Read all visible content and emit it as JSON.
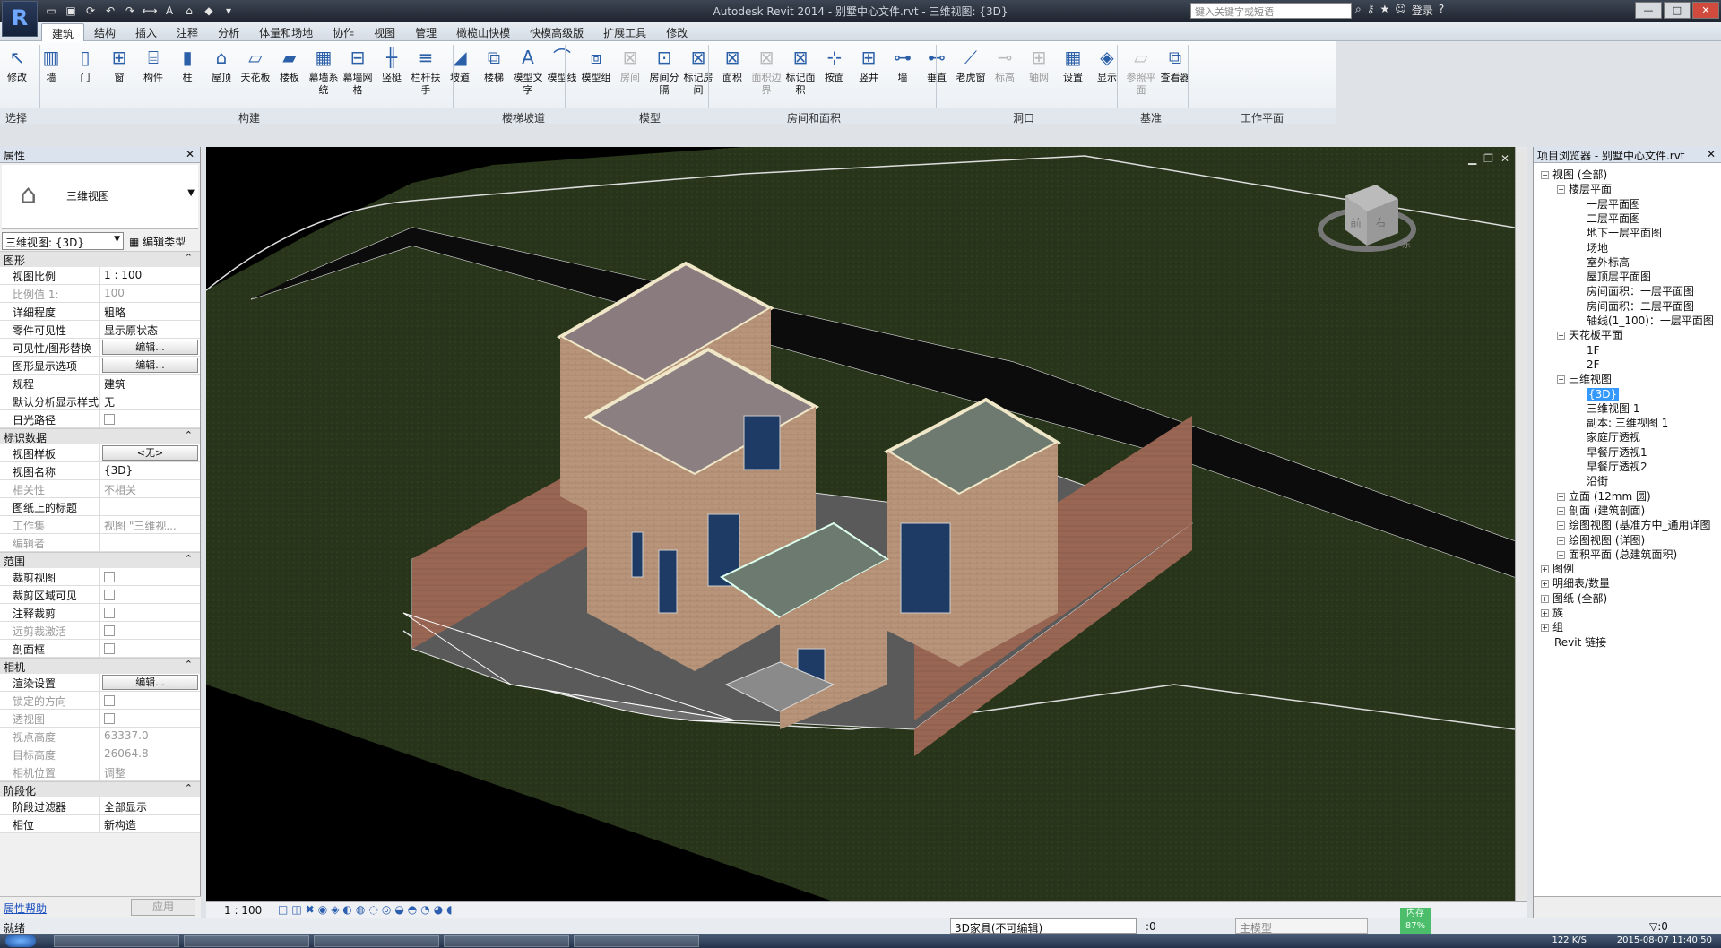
{
  "window": {
    "title": "Autodesk Revit 2014 -    别墅中心文件.rvt - 三维视图: {3D}",
    "search_placeholder": "键入关键字或短语",
    "login": "登录",
    "buttons": {
      "min": "—",
      "max": "□",
      "close": "✕"
    }
  },
  "tabs": [
    "建筑",
    "结构",
    "插入",
    "注释",
    "分析",
    "体量和场地",
    "协作",
    "视图",
    "管理",
    "橄榄山快模",
    "快模高级版",
    "扩展工具",
    "修改"
  ],
  "ribbon": {
    "tools": [
      {
        "label": "修改",
        "icon": "cursor-icon",
        "disabled": false
      },
      {
        "label": "墙",
        "icon": "wall-icon",
        "disabled": false
      },
      {
        "label": "门",
        "icon": "door-icon",
        "disabled": false
      },
      {
        "label": "窗",
        "icon": "window-icon",
        "disabled": false
      },
      {
        "label": "构件",
        "icon": "component-icon",
        "disabled": false
      },
      {
        "label": "柱",
        "icon": "column-icon",
        "disabled": false
      },
      {
        "label": "屋顶",
        "icon": "roof-icon",
        "disabled": false
      },
      {
        "label": "天花板",
        "icon": "ceiling-icon",
        "disabled": false
      },
      {
        "label": "楼板",
        "icon": "floor-icon",
        "disabled": false
      },
      {
        "label": "幕墙系统",
        "icon": "curtain-system-icon",
        "disabled": false
      },
      {
        "label": "幕墙网格",
        "icon": "curtain-grid-icon",
        "disabled": false
      },
      {
        "label": "竖梃",
        "icon": "mullion-icon",
        "disabled": false
      },
      {
        "label": "栏杆扶手",
        "icon": "railing-icon",
        "disabled": false
      },
      {
        "label": "坡道",
        "icon": "ramp-icon",
        "disabled": false
      },
      {
        "label": "楼梯",
        "icon": "stair-icon",
        "disabled": false
      },
      {
        "label": "模型文字",
        "icon": "model-text-icon",
        "disabled": false
      },
      {
        "label": "模型线",
        "icon": "model-line-icon",
        "disabled": false
      },
      {
        "label": "模型组",
        "icon": "model-group-icon",
        "disabled": false
      },
      {
        "label": "房间",
        "icon": "room-icon",
        "disabled": true
      },
      {
        "label": "房间分隔",
        "icon": "room-separator-icon",
        "disabled": false
      },
      {
        "label": "标记房间",
        "icon": "tag-room-icon",
        "disabled": false
      },
      {
        "label": "面积",
        "icon": "area-icon",
        "disabled": false
      },
      {
        "label": "面积边界",
        "icon": "area-boundary-icon",
        "disabled": true
      },
      {
        "label": "标记面积",
        "icon": "tag-area-icon",
        "disabled": false
      },
      {
        "label": "按面",
        "icon": "by-face-icon",
        "disabled": false
      },
      {
        "label": "竖井",
        "icon": "shaft-icon",
        "disabled": false
      },
      {
        "label": "墙",
        "icon": "wall-opening-icon",
        "disabled": false
      },
      {
        "label": "垂直",
        "icon": "vertical-opening-icon",
        "disabled": false
      },
      {
        "label": "老虎窗",
        "icon": "dormer-icon",
        "disabled": false
      },
      {
        "label": "标高",
        "icon": "level-icon",
        "disabled": true
      },
      {
        "label": "轴网",
        "icon": "grid-icon",
        "disabled": true
      },
      {
        "label": "设置",
        "icon": "workplane-set-icon",
        "disabled": false
      },
      {
        "label": "显示",
        "icon": "workplane-show-icon",
        "disabled": false
      },
      {
        "label": "参照平面",
        "icon": "ref-plane-icon",
        "disabled": true
      },
      {
        "label": "查看器",
        "icon": "viewer-icon",
        "disabled": false
      }
    ],
    "panels": [
      "选择",
      "构建",
      "楼梯坡道",
      "模型",
      "房间和面积",
      "洞口",
      "基准",
      "工作平面"
    ]
  },
  "properties": {
    "title": "属性",
    "type_name": "三维视图",
    "view_selector": "三维视图: {3D}",
    "edit_type": "编辑类型",
    "sections": [
      {
        "name": "图形",
        "rows": [
          {
            "k": "视图比例",
            "v": "1 : 100",
            "type": "text"
          },
          {
            "k": "比例值 1:",
            "v": "100",
            "type": "text",
            "dim": true
          },
          {
            "k": "详细程度",
            "v": "粗略",
            "type": "text"
          },
          {
            "k": "零件可见性",
            "v": "显示原状态",
            "type": "text"
          },
          {
            "k": "可见性/图形替换",
            "v": "编辑...",
            "type": "button"
          },
          {
            "k": "图形显示选项",
            "v": "编辑...",
            "type": "button"
          },
          {
            "k": "规程",
            "v": "建筑",
            "type": "text"
          },
          {
            "k": "默认分析显示样式",
            "v": "无",
            "type": "text"
          },
          {
            "k": "日光路径",
            "v": "",
            "type": "check"
          }
        ]
      },
      {
        "name": "标识数据",
        "rows": [
          {
            "k": "视图样板",
            "v": "<无>",
            "type": "button"
          },
          {
            "k": "视图名称",
            "v": "{3D}",
            "type": "text"
          },
          {
            "k": "相关性",
            "v": "不相关",
            "type": "text",
            "dim": true
          },
          {
            "k": "图纸上的标题",
            "v": "",
            "type": "text"
          },
          {
            "k": "工作集",
            "v": "视图 \"三维视...",
            "type": "text",
            "dim": true
          },
          {
            "k": "编辑者",
            "v": "",
            "type": "text",
            "dim": true
          }
        ]
      },
      {
        "name": "范围",
        "rows": [
          {
            "k": "裁剪视图",
            "v": "",
            "type": "check"
          },
          {
            "k": "裁剪区域可见",
            "v": "",
            "type": "check"
          },
          {
            "k": "注释裁剪",
            "v": "",
            "type": "check"
          },
          {
            "k": "远剪裁激活",
            "v": "",
            "type": "check",
            "dim": true
          },
          {
            "k": "剖面框",
            "v": "",
            "type": "check"
          }
        ]
      },
      {
        "name": "相机",
        "rows": [
          {
            "k": "渲染设置",
            "v": "编辑...",
            "type": "button"
          },
          {
            "k": "锁定的方向",
            "v": "",
            "type": "check",
            "dim": true
          },
          {
            "k": "透视图",
            "v": "",
            "type": "check",
            "dim": true
          },
          {
            "k": "视点高度",
            "v": "63337.0",
            "type": "text",
            "dim": true
          },
          {
            "k": "目标高度",
            "v": "26064.8",
            "type": "text",
            "dim": true
          },
          {
            "k": "相机位置",
            "v": "调整",
            "type": "text",
            "dim": true
          }
        ]
      },
      {
        "name": "阶段化",
        "rows": [
          {
            "k": "阶段过滤器",
            "v": "全部显示",
            "type": "text"
          },
          {
            "k": "相位",
            "v": "新构造",
            "type": "text"
          }
        ]
      }
    ],
    "help_link": "属性帮助",
    "apply": "应用"
  },
  "viewcube": {
    "front": "前",
    "right": "右",
    "compass": "东"
  },
  "view_bar": {
    "scale": "1 : 100"
  },
  "browser": {
    "title": "项目浏览器 - 别墅中心文件.rvt",
    "nodes": [
      {
        "t": "视图 (全部)",
        "lvl": 0,
        "exp": "−"
      },
      {
        "t": "楼层平面",
        "lvl": 1,
        "exp": "−"
      },
      {
        "t": "一层平面图",
        "lvl": 2
      },
      {
        "t": "二层平面图",
        "lvl": 2
      },
      {
        "t": "地下一层平面图",
        "lvl": 2
      },
      {
        "t": "场地",
        "lvl": 2
      },
      {
        "t": "室外标高",
        "lvl": 2
      },
      {
        "t": "屋顶层平面图",
        "lvl": 2
      },
      {
        "t": "房间面积：一层平面图",
        "lvl": 2
      },
      {
        "t": "房间面积：二层平面图",
        "lvl": 2
      },
      {
        "t": "轴线(1_100)：一层平面图",
        "lvl": 2
      },
      {
        "t": "天花板平面",
        "lvl": 1,
        "exp": "−"
      },
      {
        "t": "1F",
        "lvl": 2
      },
      {
        "t": "2F",
        "lvl": 2
      },
      {
        "t": "三维视图",
        "lvl": 1,
        "exp": "−"
      },
      {
        "t": "{3D}",
        "lvl": 2,
        "sel": true
      },
      {
        "t": "三维视图 1",
        "lvl": 2
      },
      {
        "t": "副本: 三维视图 1",
        "lvl": 2
      },
      {
        "t": "家庭厅透视",
        "lvl": 2
      },
      {
        "t": "早餐厅透视1",
        "lvl": 2
      },
      {
        "t": "早餐厅透视2",
        "lvl": 2
      },
      {
        "t": "沿街",
        "lvl": 2
      },
      {
        "t": "立面 (12mm 圆)",
        "lvl": 1,
        "exp": "+"
      },
      {
        "t": "剖面 (建筑剖面)",
        "lvl": 1,
        "exp": "+"
      },
      {
        "t": "绘图视图 (基准方中_通用详图",
        "lvl": 1,
        "exp": "+"
      },
      {
        "t": "绘图视图 (详图)",
        "lvl": 1,
        "exp": "+"
      },
      {
        "t": "面积平面 (总建筑面积)",
        "lvl": 1,
        "exp": "+"
      },
      {
        "t": "图例",
        "lvl": 0,
        "exp": "+"
      },
      {
        "t": "明细表/数量",
        "lvl": 0,
        "exp": "+"
      },
      {
        "t": "图纸 (全部)",
        "lvl": 0,
        "exp": "+"
      },
      {
        "t": "族",
        "lvl": 0,
        "exp": "+"
      },
      {
        "t": "组",
        "lvl": 0,
        "exp": "+"
      },
      {
        "t": "Revit 链接",
        "lvl": 0
      }
    ]
  },
  "status": {
    "message": "就绪",
    "workset": "3D家具(不可编辑)",
    "count": ":0",
    "model": "主模型",
    "memory_label": "内存",
    "memory_value": "87%",
    "filter": ":0"
  },
  "taskbar": {
    "clock": "2015-08-07 11:40:50",
    "speed": "122 K/S"
  }
}
